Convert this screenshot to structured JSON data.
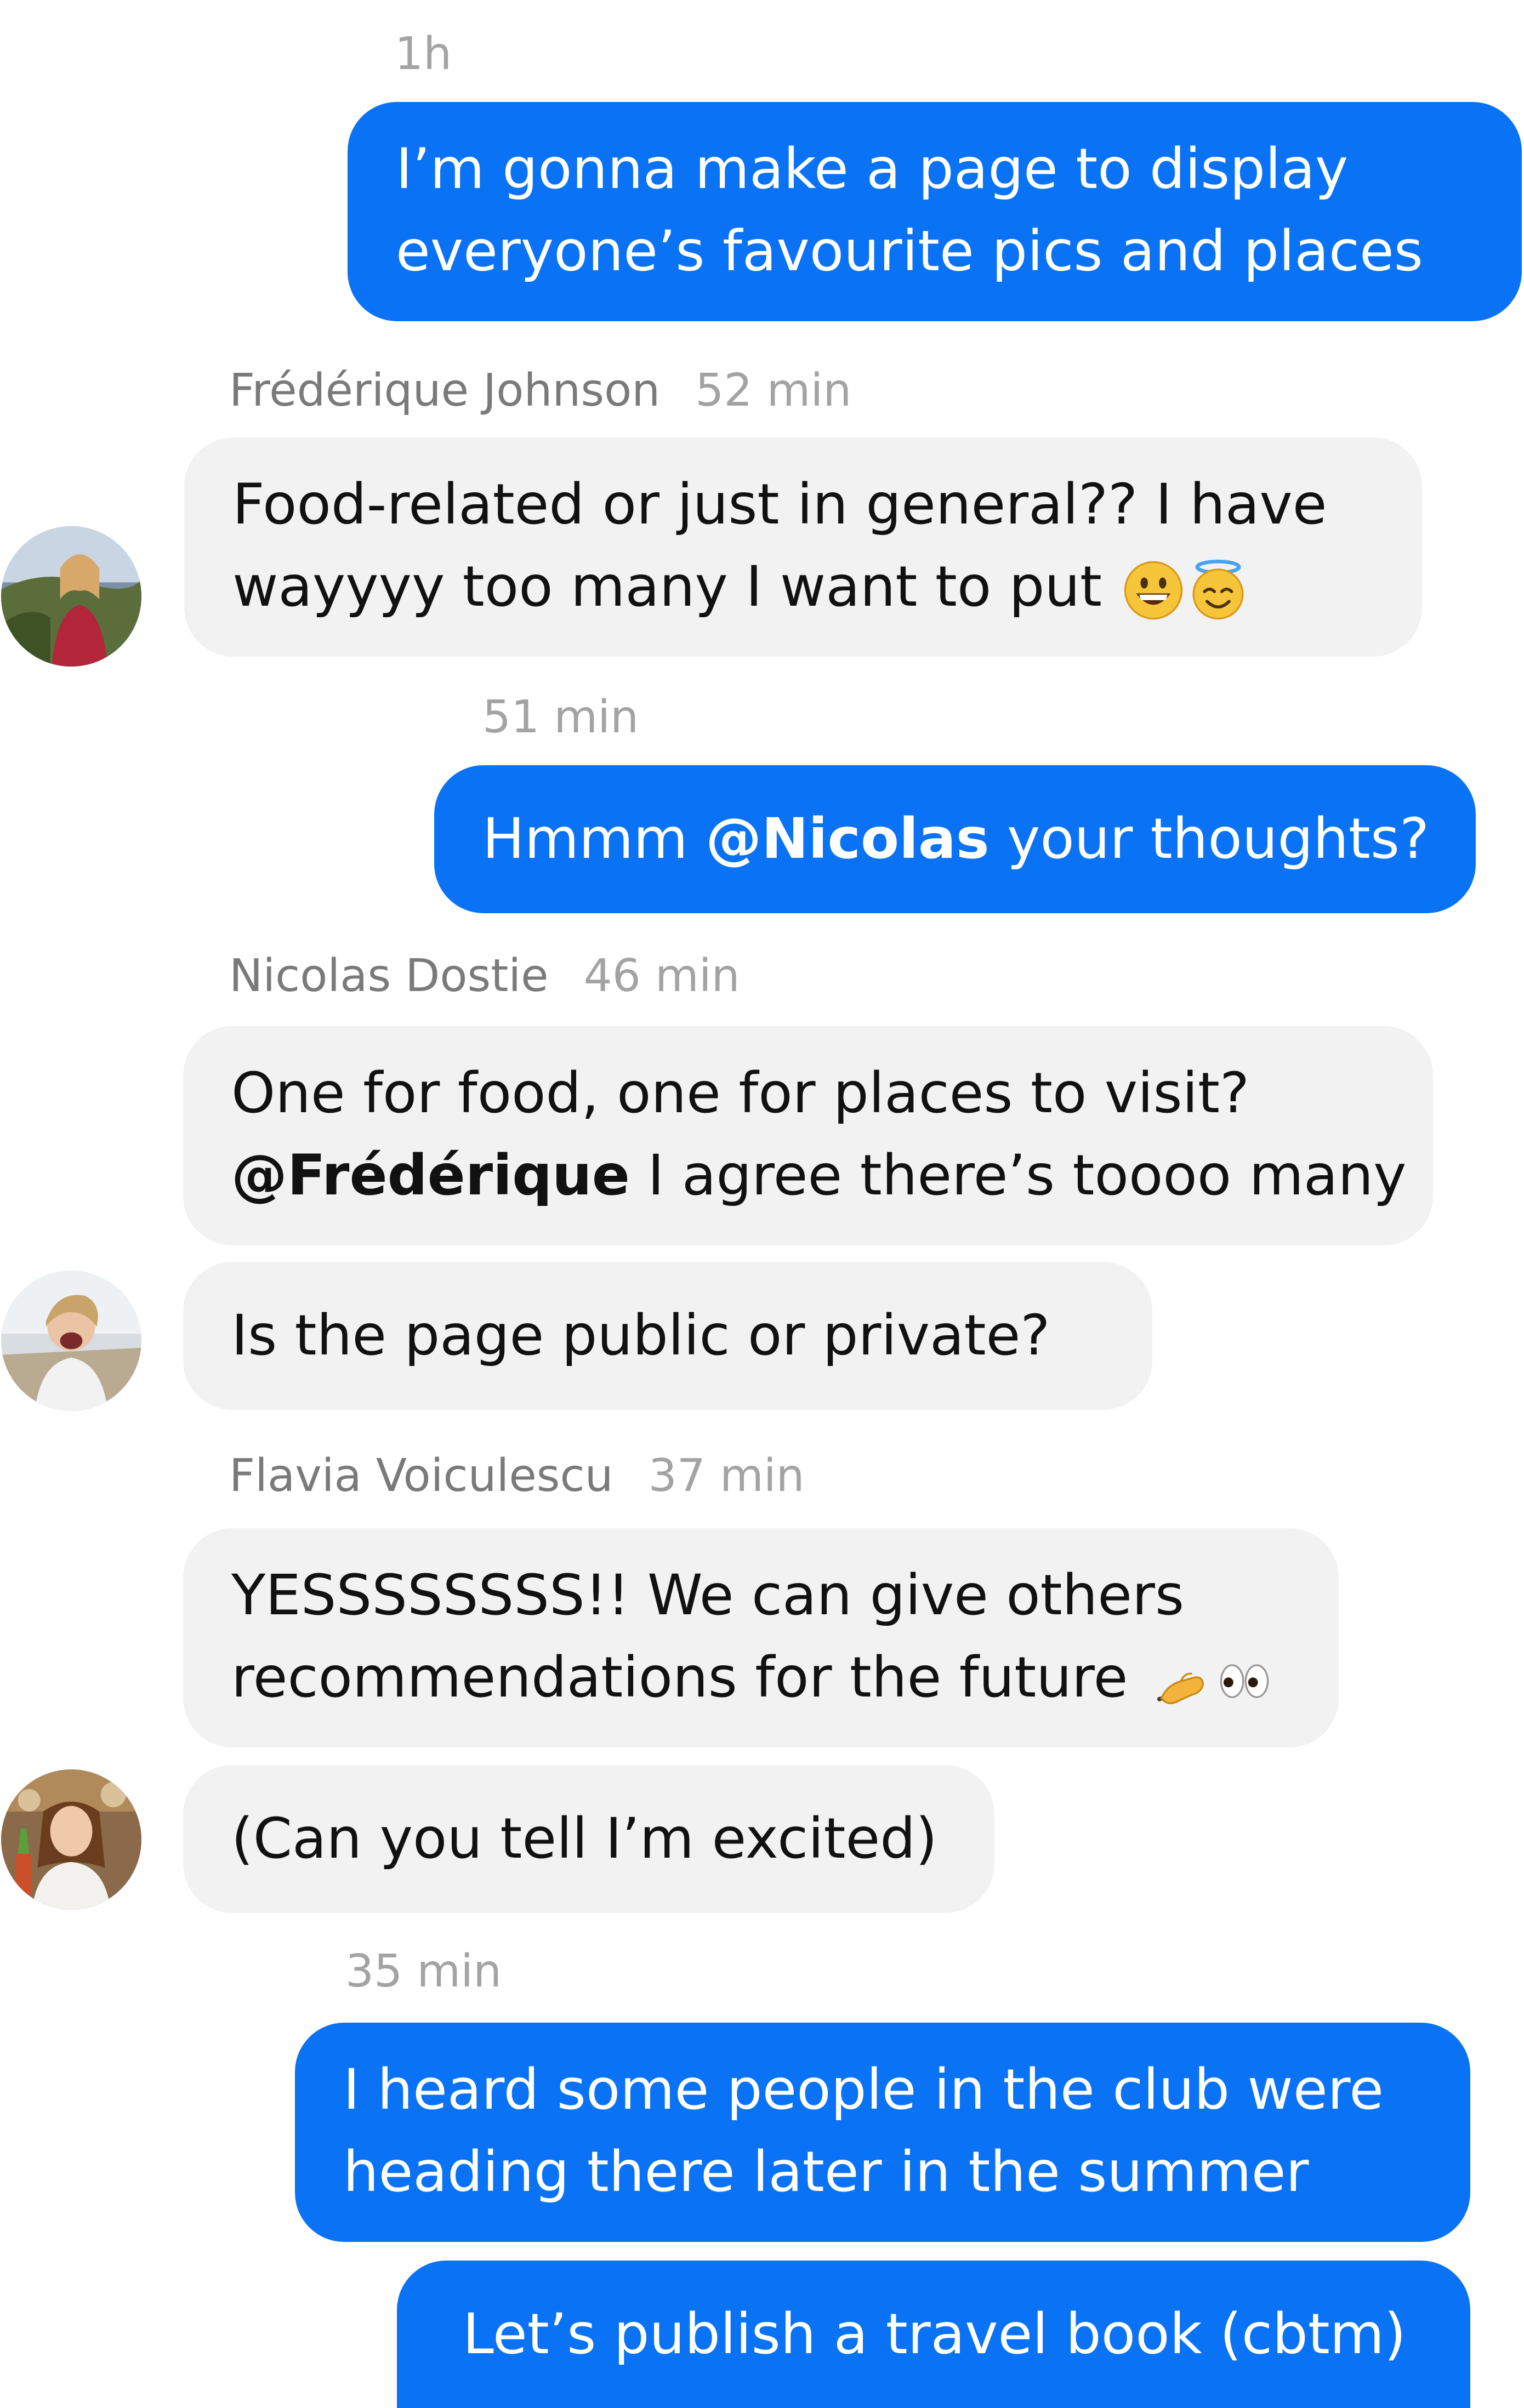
{
  "conversation": [
    {
      "type": "timestamp",
      "text": "1h"
    },
    {
      "type": "outgoing",
      "lines": [
        "I’m gonna make a page to display",
        "everyone’s favourite pics and places"
      ]
    },
    {
      "type": "sender",
      "name": "Frédérique Johnson",
      "time": "52 min"
    },
    {
      "type": "incoming",
      "lines": [
        "Food-related or just in general?? I have",
        "wayyyy too many I want to put"
      ],
      "emojis": [
        "grinning-face-icon",
        "smiling-face-with-halo-icon"
      ]
    },
    {
      "type": "timestamp",
      "text": "51 min"
    },
    {
      "type": "outgoing",
      "before": "Hmmm ",
      "mention": "@Nicolas",
      "after": " your thoughts?"
    },
    {
      "type": "sender",
      "name": "Nicolas Dostie",
      "time": "46 min"
    },
    {
      "type": "incoming",
      "line1": "One for food, one for places to visit?",
      "mention": "@Frédérique",
      "after": " I agree there’s toooo many"
    },
    {
      "type": "incoming",
      "text": "Is the page public or private?"
    },
    {
      "type": "sender",
      "name": "Flavia Voiculescu",
      "time": "37 min"
    },
    {
      "type": "incoming",
      "lines": [
        "YESSSSSSSS!! We can give others",
        "recommendations for the future"
      ],
      "emojis": [
        "writing-hand-icon",
        "eyes-icon"
      ]
    },
    {
      "type": "incoming",
      "text": "(Can you tell I’m excited)"
    },
    {
      "type": "timestamp",
      "text": "35 min"
    },
    {
      "type": "outgoing",
      "lines": [
        "I heard some people in the club were",
        "heading there later in the summer"
      ]
    },
    {
      "type": "outgoing",
      "text": "Let’s publish a travel book (cbtm)"
    }
  ],
  "colors": {
    "outgoing_bubble": "#0a72f5",
    "incoming_bubble": "#f2f2f2",
    "meta_text": "#a3a3a3",
    "sender_text": "#7a7a7a"
  }
}
